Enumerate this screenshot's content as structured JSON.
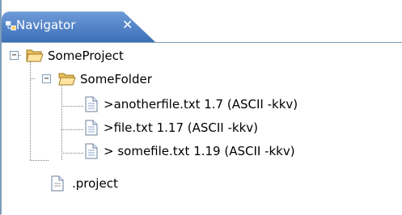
{
  "view": {
    "tab_title": "Navigator",
    "tab_icon": "navigator-icon",
    "close_icon": "close-icon"
  },
  "tree": {
    "project": {
      "label": "SomeProject",
      "expanded": true,
      "icon": "folder-open-icon"
    },
    "folder": {
      "label": "SomeFolder",
      "expanded": true,
      "icon": "folder-open-icon"
    },
    "files": [
      {
        "label": ">anotherfile.txt 1.7  (ASCII -kkv)",
        "icon": "text-file-icon"
      },
      {
        "label": ">file.txt 1.17  (ASCII -kkv)",
        "icon": "text-file-icon"
      },
      {
        "label": "> somefile.txt 1.19  (ASCII -kkv)",
        "icon": "text-file-icon"
      }
    ],
    "project_file": {
      "label": ".project",
      "icon": "file-icon"
    }
  },
  "colors": {
    "tab_top": "#6d9ad7",
    "tab_bottom": "#3c6fb8",
    "border": "#7f9db9",
    "folder": "#f0c060"
  }
}
